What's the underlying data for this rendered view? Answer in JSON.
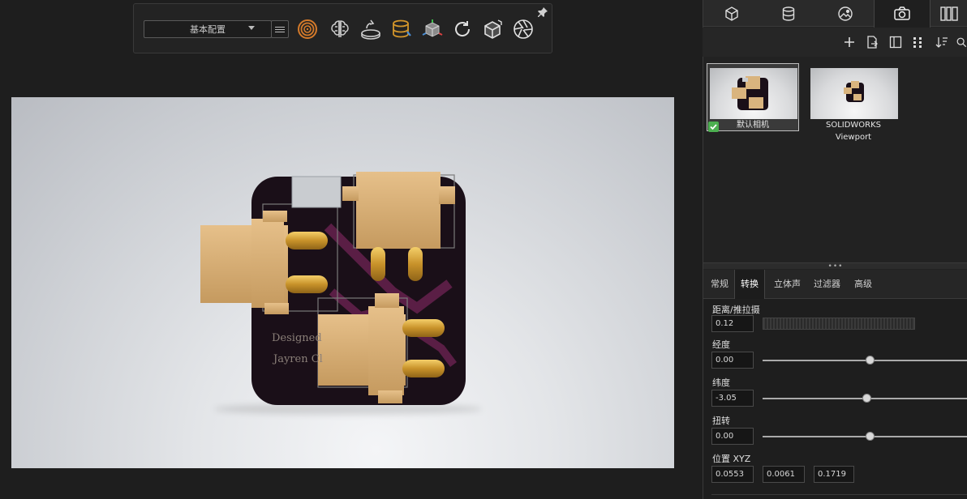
{
  "toolbar": {
    "config_value": "基本配置",
    "icons": [
      "render-rings-icon",
      "brain-icon",
      "turntable-icon",
      "material-icon",
      "model-axes-icon",
      "refresh-icon",
      "cube-icon",
      "aperture-icon",
      "pin-icon"
    ]
  },
  "viewport": {
    "model_text_line1": "Designed",
    "model_text_line2": "Jayren Cl"
  },
  "side": {
    "tabs": [
      "cube-icon",
      "database-icon",
      "environment-icon",
      "camera-icon",
      "panels-icon"
    ],
    "active_tab": "camera-icon",
    "actions": [
      "plus-icon",
      "export-icon",
      "layout-icon",
      "grid-icon",
      "sort-icon",
      "search-icon"
    ],
    "cameras": [
      {
        "label": "默认相机",
        "selected": true
      },
      {
        "label": "SOLIDWORKS Viewport",
        "selected": false
      }
    ],
    "splitter_dots": "•••",
    "prop_tabs": [
      "常规",
      "转换",
      "立体声",
      "过滤器",
      "高级"
    ],
    "active_prop_tab": "转换",
    "props": {
      "distance_label": "距离/推拉摄",
      "distance_value": "0.12",
      "longitude_label": "经度",
      "longitude_value": "0.00",
      "longitude_level": 0.5,
      "latitude_label": "纬度",
      "latitude_value": "-3.05",
      "latitude_level": 0.47,
      "twist_label": "扭转",
      "twist_value": "0.00",
      "twist_level": 0.5,
      "position_label": "位置 XYZ",
      "pos_x": "0.0553",
      "pos_y": "0.0061",
      "pos_z": "0.1719"
    }
  },
  "colors": {
    "accent_orange": "#d47a2a",
    "pcb": "#1a0f18",
    "trace": "#5a1e45",
    "connector": "#d9b47e",
    "check": "#4caf50"
  }
}
